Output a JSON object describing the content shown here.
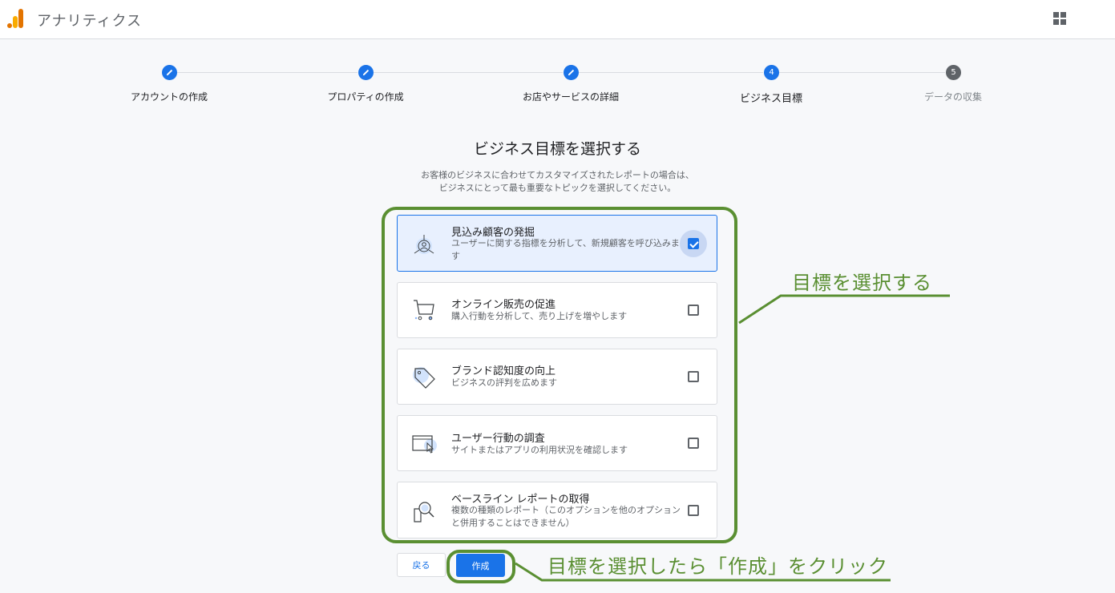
{
  "header": {
    "app_title": "アナリティクス",
    "logo_icon": "analytics-logo-icon",
    "apps_icon": "apps-grid-icon"
  },
  "stepper": {
    "steps": [
      {
        "label": "アカウントの作成",
        "state": "done",
        "number": "1"
      },
      {
        "label": "プロパティの作成",
        "state": "done",
        "number": "2"
      },
      {
        "label": "お店やサービスの詳細",
        "state": "done",
        "number": "3"
      },
      {
        "label": "ビジネス目標",
        "state": "current",
        "number": "4"
      },
      {
        "label": "データの収集",
        "state": "pending",
        "number": "5"
      }
    ]
  },
  "main": {
    "title": "ビジネス目標を選択する",
    "subtitle_line1": "お客様のビジネスに合わせてカスタマイズされたレポートの場合は、",
    "subtitle_line2": "ビジネスにとって最も重要なトピックを選択してください。"
  },
  "options": [
    {
      "title": "見込み顧客の発掘",
      "desc": "ユーザーに関する指標を分析して、新規顧客を呼び込みます",
      "checked": true,
      "icon": "target-user-icon"
    },
    {
      "title": "オンライン販売の促進",
      "desc": "購入行動を分析して、売り上げを増やします",
      "checked": false,
      "icon": "shopping-cart-icon"
    },
    {
      "title": "ブランド認知度の向上",
      "desc": "ビジネスの評判を広めます",
      "checked": false,
      "icon": "price-tag-icon"
    },
    {
      "title": "ユーザー行動の調査",
      "desc": "サイトまたはアプリの利用状況を確認します",
      "checked": false,
      "icon": "browser-cursor-icon"
    },
    {
      "title": "ベースライン レポートの取得",
      "desc": "複数の種類のレポート（このオプションを他のオプションと併用することはできません）",
      "checked": false,
      "icon": "magnifier-doc-icon"
    }
  ],
  "buttons": {
    "back": "戻る",
    "create": "作成"
  },
  "annotations": {
    "select_goal": "目標を選択する",
    "click_create": "目標を選択したら「作成」をクリック",
    "color": "#5a8f32"
  },
  "colors": {
    "accent": "#1a73e8",
    "selected_bg": "#e8f0fe"
  }
}
